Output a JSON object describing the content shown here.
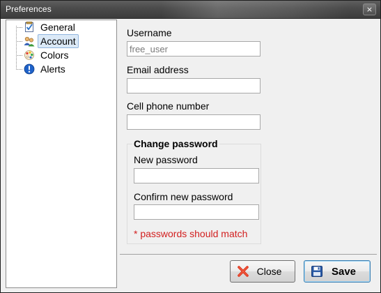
{
  "window": {
    "title": "Preferences",
    "close_glyph": "×"
  },
  "tree": {
    "items": [
      {
        "label": "General",
        "icon": "checklist-icon",
        "selected": false
      },
      {
        "label": "Account",
        "icon": "users-icon",
        "selected": true
      },
      {
        "label": "Colors",
        "icon": "palette-icon",
        "selected": false
      },
      {
        "label": "Alerts",
        "icon": "alert-info-icon",
        "selected": false
      }
    ]
  },
  "account": {
    "username_label": "Username",
    "username_value": "free_user",
    "email_label": "Email address",
    "email_value": "",
    "phone_label": "Cell phone number",
    "phone_value": "",
    "password_group": {
      "title": "Change password",
      "new_label": "New password",
      "new_value": "",
      "confirm_label": "Confirm new password",
      "confirm_value": "",
      "warning": "* passwords should match"
    }
  },
  "buttons": {
    "close_label": "Close",
    "close_icon": "red-x-icon",
    "save_label": "Save",
    "save_icon": "floppy-disk-icon"
  },
  "colors": {
    "title_bar": "#4a4a4a",
    "selection": "#dbe9f7",
    "warning_text": "#d21e1e",
    "save_icon_blue": "#2a5aa6",
    "close_icon_red": "#e0361e"
  }
}
